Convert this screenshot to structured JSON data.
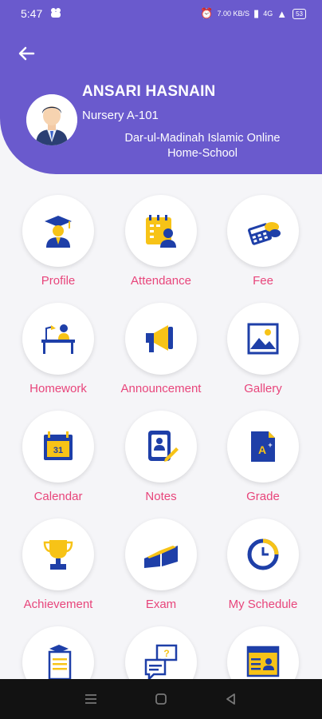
{
  "status_bar": {
    "time": "5:47",
    "net_speed": "7.00 KB/S",
    "network": "4G",
    "battery": "53"
  },
  "header": {
    "student_name": "ANSARI HASNAIN",
    "class_name": "Nursery A-101",
    "school_name": "Dar-ul-Madinah Islamic Online Home-School"
  },
  "menu": {
    "profile": "Profile",
    "attendance": "Attendance",
    "fee": "Fee",
    "homework": "Homework",
    "announcement": "Announcement",
    "gallery": "Gallery",
    "calendar": "Calendar",
    "notes": "Notes",
    "grade": "Grade",
    "achievement": "Achievement",
    "exam": "Exam",
    "my_schedule": "My Schedule",
    "calendar_date": "31"
  },
  "colors": {
    "header": "#6a5acd",
    "label": "#e8457b",
    "icon_blue": "#1e3fa8",
    "icon_yellow": "#f7c317"
  }
}
